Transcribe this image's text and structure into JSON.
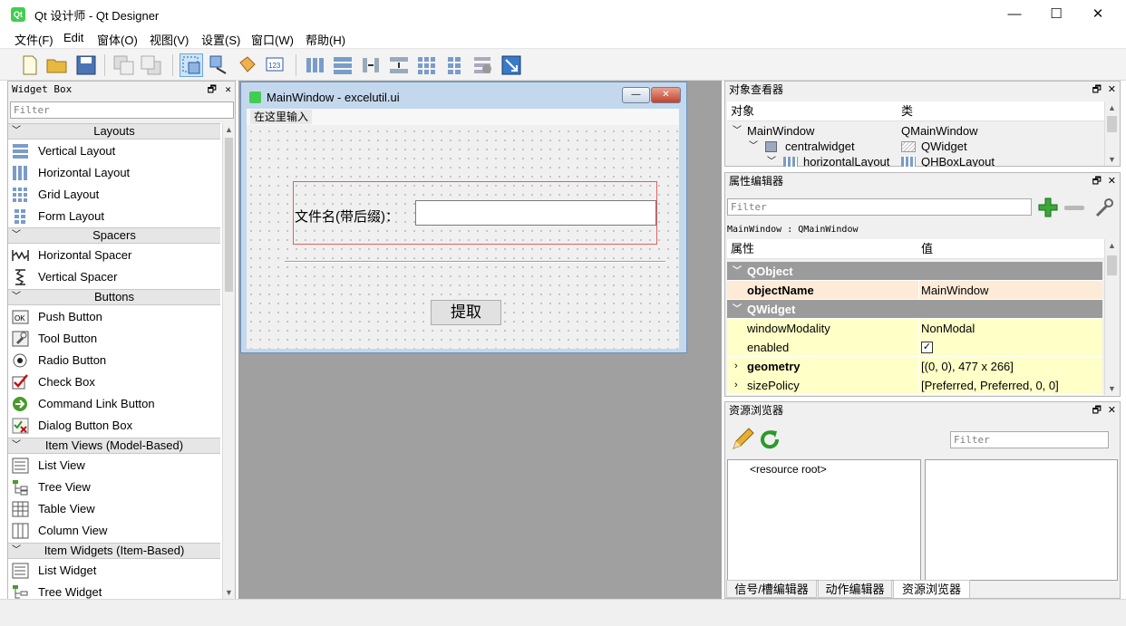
{
  "window": {
    "title": "Qt 设计师 - Qt Designer",
    "icon": "qt-icon",
    "minimize": "—",
    "maximize": "☐",
    "close": "✕"
  },
  "menu": [
    "文件(F)",
    "Edit",
    "窗体(O)",
    "视图(V)",
    "设置(S)",
    "窗口(W)",
    "帮助(H)"
  ],
  "widget_box": {
    "title": "Widget Box",
    "filter_placeholder": "Filter",
    "categories": {
      "layouts": "Layouts",
      "spacers": "Spacers",
      "buttons": "Buttons",
      "item_views": "Item Views (Model-Based)",
      "item_widgets": "Item Widgets (Item-Based)"
    },
    "items": {
      "vertical_layout": "Vertical Layout",
      "horizontal_layout": "Horizontal Layout",
      "grid_layout": "Grid Layout",
      "form_layout": "Form Layout",
      "horizontal_spacer": "Horizontal Spacer",
      "vertical_spacer": "Vertical Spacer",
      "push_button": "Push Button",
      "tool_button": "Tool Button",
      "radio_button": "Radio Button",
      "check_box": "Check Box",
      "command_link_button": "Command Link Button",
      "dialog_button_box": "Dialog Button Box",
      "list_view": "List View",
      "tree_view": "Tree View",
      "table_view": "Table View",
      "column_view": "Column View",
      "list_widget": "List Widget",
      "tree_widget": "Tree Widget"
    }
  },
  "form": {
    "title": "MainWindow - excelutil.ui",
    "menu_placeholder": "在这里输入",
    "label": "文件名(带后缀)：",
    "button": "提取"
  },
  "object_inspector": {
    "title": "对象查看器",
    "col_object": "对象",
    "col_class": "类",
    "rows": [
      {
        "name": "MainWindow",
        "cls": "QMainWindow"
      },
      {
        "name": "centralwidget",
        "cls": "QWidget"
      },
      {
        "name": "horizontalLayout",
        "cls": "QHBoxLayout"
      }
    ]
  },
  "property_editor": {
    "title": "属性编辑器",
    "filter_placeholder": "Filter",
    "context": "MainWindow : QMainWindow",
    "col_property": "属性",
    "col_value": "值",
    "group_qobject": "QObject",
    "object_name_key": "objectName",
    "object_name_val": "MainWindow",
    "group_qwidget": "QWidget",
    "window_modality_key": "windowModality",
    "window_modality_val": "NonModal",
    "enabled_key": "enabled",
    "geometry_key": "geometry",
    "geometry_val": "[(0, 0), 477 x 266]",
    "size_policy_key": "sizePolicy",
    "size_policy_val": "[Preferred, Preferred, 0, 0]"
  },
  "resource_browser": {
    "title": "资源浏览器",
    "filter_placeholder": "Filter",
    "root": "<resource root>"
  },
  "tabs": {
    "signals": "信号/槽编辑器",
    "actions": "动作编辑器",
    "resources": "资源浏览器"
  },
  "dock_controls": {
    "float": "🗗",
    "close": "✕"
  },
  "colors": {
    "accent": "#41cd52",
    "selected": "#cde3f7",
    "group": "#9b9b9b",
    "qobject_row": "#fdebd8",
    "qwidget_row": "#ffffc8"
  }
}
